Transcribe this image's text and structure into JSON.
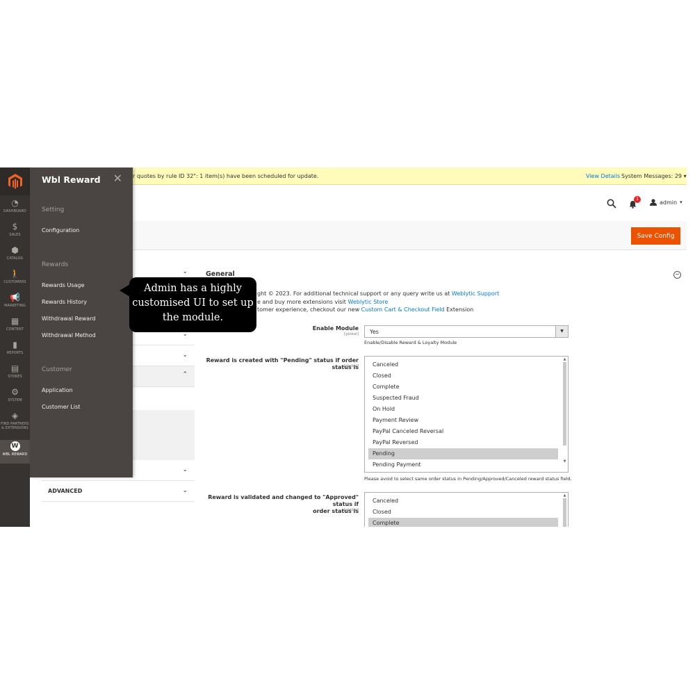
{
  "nav": {
    "items": [
      {
        "icon": "dashboard-icon",
        "label": "DASHBOARD"
      },
      {
        "icon": "dollar-icon",
        "label": "SALES"
      },
      {
        "icon": "cube-icon",
        "label": "CATALOG"
      },
      {
        "icon": "person-icon",
        "label": "CUSTOMERS"
      },
      {
        "icon": "megaphone-icon",
        "label": "MARKETING"
      },
      {
        "icon": "layout-icon",
        "label": "CONTENT"
      },
      {
        "icon": "bar-chart-icon",
        "label": "REPORTS"
      },
      {
        "icon": "store-icon",
        "label": "STORES"
      },
      {
        "icon": "gear-icon",
        "label": "SYSTEM"
      },
      {
        "icon": "box-icon",
        "label": "FIND PARTNERS",
        "label2": "& EXTENSIONS"
      },
      {
        "icon": "wbl-icon",
        "label": "WBL REWARD",
        "glyph": "W"
      }
    ]
  },
  "flyout": {
    "title": "Wbl Reward",
    "close": "✕",
    "groups": [
      {
        "title": "Setting",
        "links": [
          "Configuration"
        ]
      },
      {
        "title": "Rewards",
        "links": [
          "Rewards Usage",
          "Rewards History",
          "Withdrawal Reward",
          "Withdrawal Method"
        ]
      },
      {
        "title": "Customer",
        "links": [
          "Application",
          "Customer List"
        ]
      }
    ]
  },
  "notice": {
    "message": "r quotes by rule ID 32\": 1 item(s) have been scheduled for update.",
    "view_details": "View Details",
    "system_messages": "System Messages: 29"
  },
  "header": {
    "bell_count": "1",
    "user": "admin"
  },
  "actions": {
    "save_label": "Save Config"
  },
  "tabs": {
    "advanced": "ADVANCED"
  },
  "callout": {
    "line1": "Admin has a highly",
    "line2": "customised UI to set up",
    "line3": "the module."
  },
  "general": {
    "title": "General",
    "info": [
      {
        "pre": "ght © 2023. For additional technical support or any query write us at ",
        "link": "Weblytic Support",
        "post": ""
      },
      {
        "pre": "e and buy more extensions visit ",
        "link": "Weblytic Store",
        "post": ""
      },
      {
        "pre": "tomer experience, checkout our new ",
        "link": "Custom Cart & Checkout Field",
        "post": " Extension"
      }
    ],
    "enable_module": {
      "label": "Enable Module",
      "scope": "[global]",
      "value": "Yes",
      "note": "Enable/Disable Reward & Loyalty Module"
    },
    "pending": {
      "label": "Reward is created with \"Pending\" status if order status is",
      "scope": "[global]",
      "options": [
        "Canceled",
        "Closed",
        "Complete",
        "Suspected Fraud",
        "On Hold",
        "Payment Review",
        "PayPal Canceled Reversal",
        "PayPal Reversed",
        "Pending",
        "Pending Payment"
      ],
      "selected": [
        8
      ],
      "note": "Please avoid to select same order status in Pending/Approved/Canceled reward status field."
    },
    "approved": {
      "label_line1": "Reward is validated and changed to \"Approved\" status if",
      "label_line2": "order status is",
      "scope": "[global]",
      "options": [
        "Canceled",
        "Closed",
        "Complete"
      ],
      "selected": [
        2
      ]
    }
  }
}
